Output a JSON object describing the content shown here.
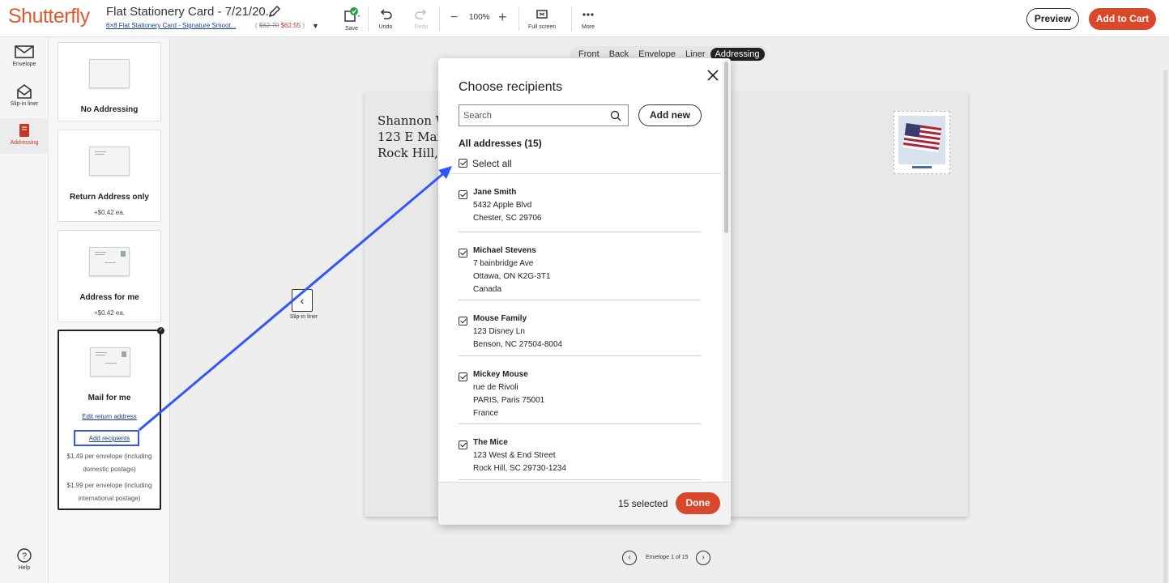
{
  "header": {
    "logo": "Shutterfly",
    "project_title": "Flat Stationery Card - 7/21/20...",
    "project_subtitle": "6×8 Flat Stationery Card - Signature Smoot...",
    "price_old": "$62.70",
    "price_new": "$62.55",
    "price_open": "(",
    "price_close": ")",
    "tools": {
      "save": "Save",
      "undo": "Undo",
      "redo": "Redo",
      "zoom": "100%",
      "fullscreen": "Full screen",
      "more": "More"
    },
    "preview_label": "Preview",
    "add_to_cart_label": "Add to Cart"
  },
  "rail": {
    "envelope": "Envelope",
    "slip_in_liner": "Slip-in liner",
    "addressing": "Addressing",
    "help": "Help"
  },
  "options": [
    {
      "title": "No Addressing"
    },
    {
      "title": "Return Address only",
      "price": "+$0.42 ea."
    },
    {
      "title": "Address for me",
      "price": "+$0.42 ea."
    },
    {
      "title": "Mail for me",
      "edit_link": "Edit return address",
      "add_link": "Add recipients",
      "note1_a": "$1.49 per envelope (including",
      "note1_b": "domestic postage)",
      "note2_a": "$1.99 per envelope (including",
      "note2_b": "international postage)"
    }
  ],
  "view_tabs": [
    "Front",
    "Back",
    "Envelope",
    "Liner",
    "Addressing"
  ],
  "active_view_tab": "Addressing",
  "envelope": {
    "return_line1": "Shannon W",
    "return_line2": "123 E Main",
    "return_line3": "Rock Hill,",
    "prev_label": "Slip-in liner",
    "pager_text": "Envelope 1 of 15"
  },
  "modal": {
    "title": "Choose recipients",
    "search_placeholder": "Search",
    "add_new_label": "Add new",
    "all_addresses_label": "All addresses (15)",
    "select_all_label": "Select all",
    "recipients": [
      {
        "name": "Jane Smith",
        "lines": [
          "5432 Apple Blvd",
          "Chester, SC 29706"
        ]
      },
      {
        "name": "Michael Stevens",
        "lines": [
          "7 bainbridge Ave",
          "Ottawa, ON K2G-3T1",
          "Canada"
        ]
      },
      {
        "name": "Mouse Family",
        "lines": [
          "123 Disney Ln",
          "Benson, NC 27504-8004"
        ]
      },
      {
        "name": "Mickey Mouse",
        "lines": [
          "rue de Rivoli",
          "PARIS, Paris 75001",
          "France"
        ]
      },
      {
        "name": "The Mice",
        "lines": [
          "123 West & End Street",
          "Rock Hill, SC 29730-1234"
        ]
      }
    ],
    "selected_count": "15 selected",
    "done_label": "Done"
  },
  "colors": {
    "brand": "#e05a2f",
    "cta": "#d9482b",
    "annotation": "#3355ff",
    "link": "#1a3e8c"
  }
}
